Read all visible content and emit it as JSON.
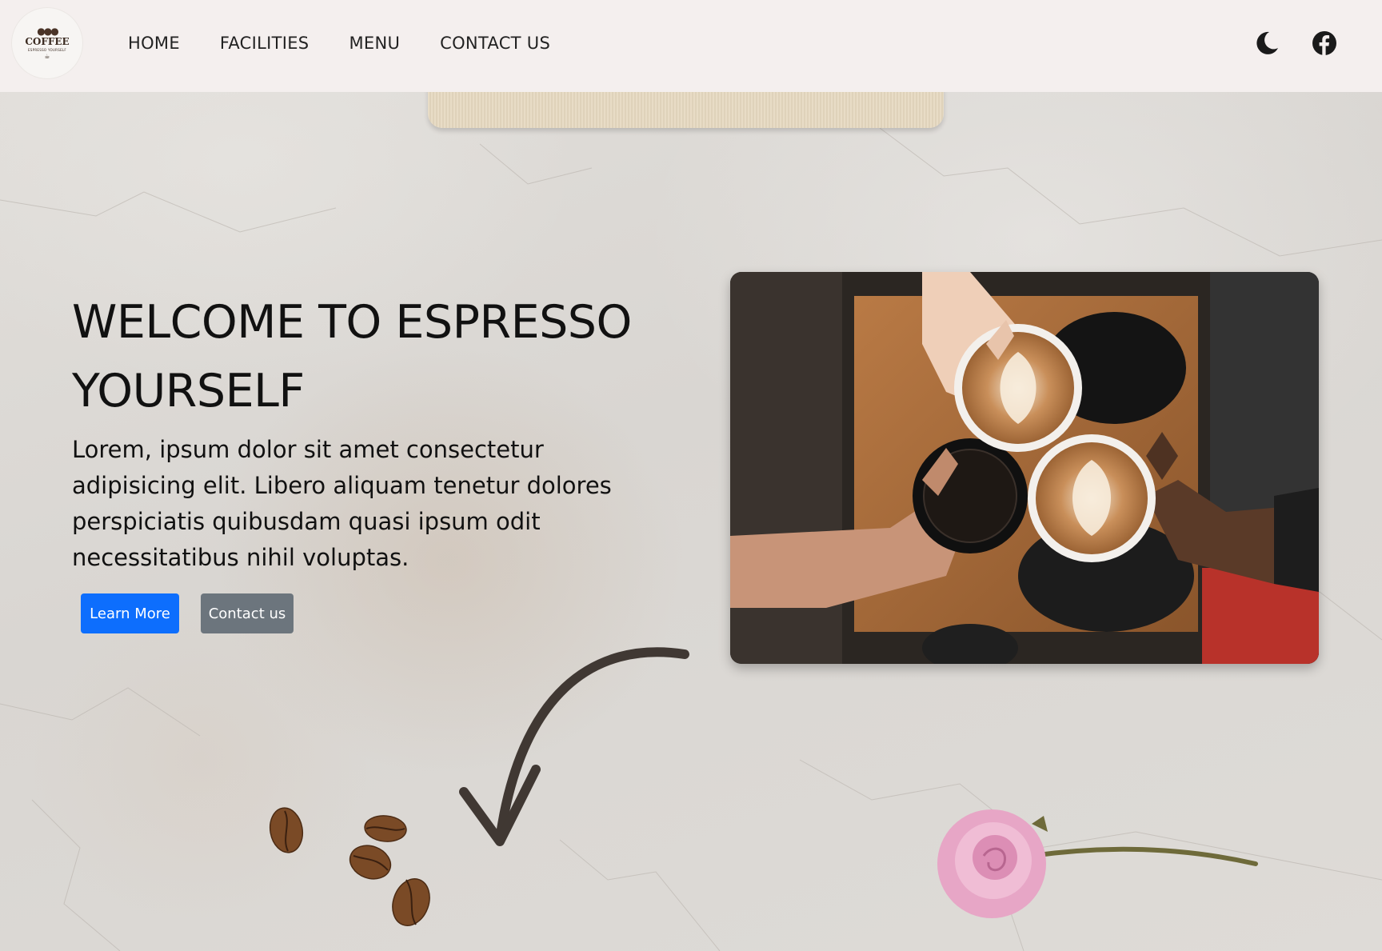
{
  "brand": {
    "logo_title": "COFFEE",
    "logo_subtitle": "ESPRESSO YOURSELF"
  },
  "nav": {
    "items": [
      {
        "label": "HOME"
      },
      {
        "label": "FACILITIES"
      },
      {
        "label": "MENU"
      },
      {
        "label": "CONTACT US"
      }
    ],
    "icons": [
      "moon-icon",
      "facebook-icon"
    ]
  },
  "hero": {
    "title": "WELCOME TO ESPRESSO YOURSELF",
    "text": "Lorem, ipsum dolor sit amet consectetur adipisicing elit. Libero aliquam tenetur dolores perspiciatis quibusdam quasi ipsum odit necessitatibus nihil voluptas.",
    "primary_button": "Learn More",
    "secondary_button": "Contact us"
  },
  "colors": {
    "navbar": "#f4efee",
    "primary": "#0d6efd",
    "secondary": "#6c757d",
    "text": "#111111"
  }
}
